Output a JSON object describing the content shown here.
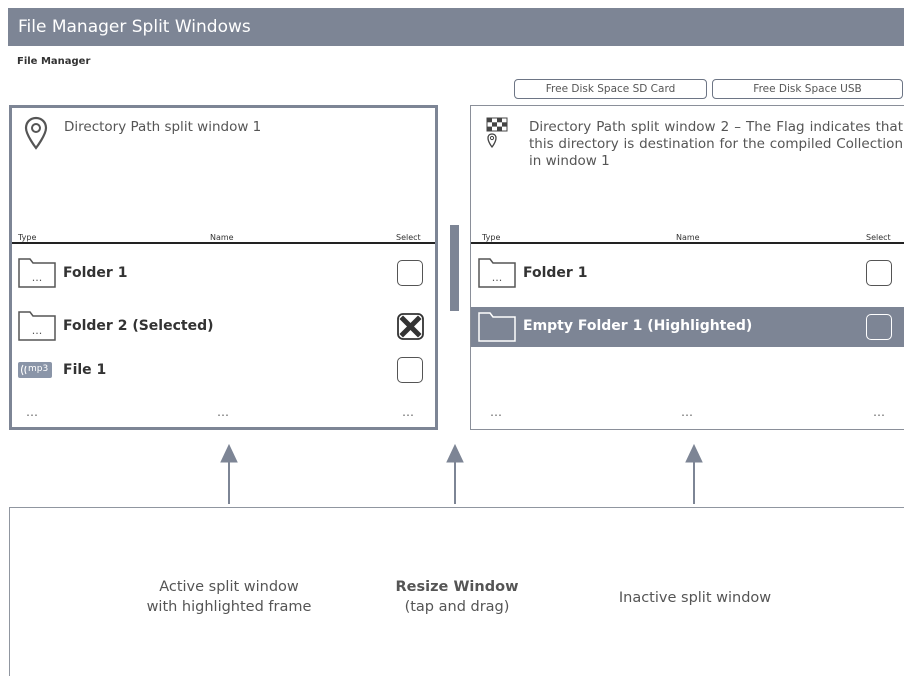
{
  "window": {
    "title": "File Manager Split Windows",
    "subtitle": "File Manager"
  },
  "disk": {
    "sd_label": "Free Disk Space SD Card",
    "usb_label": "Free Disk Space USB"
  },
  "columns": {
    "type": "Type",
    "name": "Name",
    "select": "Select"
  },
  "split1": {
    "path": "Directory Path split window 1",
    "items": [
      {
        "label": "Folder 1",
        "icon": "folder-icon",
        "selected": false
      },
      {
        "label": "Folder 2 (Selected)",
        "icon": "folder-icon",
        "selected": true
      },
      {
        "label": "File 1",
        "icon": "mp3-file-icon",
        "file_badge": "mp3",
        "selected": false
      }
    ],
    "ellipsis": "…"
  },
  "split2": {
    "path": "Directory Path split window 2 – The Flag indicates that this directory is destination for the compiled Collection in window 1",
    "items": [
      {
        "label": "Folder 1",
        "icon": "folder-icon",
        "highlighted": false
      },
      {
        "label": "Empty Folder 1 (Highlighted)",
        "icon": "empty-folder-icon",
        "highlighted": true
      }
    ],
    "ellipsis": "…"
  },
  "captions": {
    "active_line1": "Active split window",
    "active_line2": "with highlighted frame",
    "resize_bold": "Resize Window",
    "resize_sub": "(tap and drag)",
    "inactive": "Inactive split window"
  },
  "colors": {
    "accent": "#7d8595",
    "title_text": "#ffffff"
  }
}
